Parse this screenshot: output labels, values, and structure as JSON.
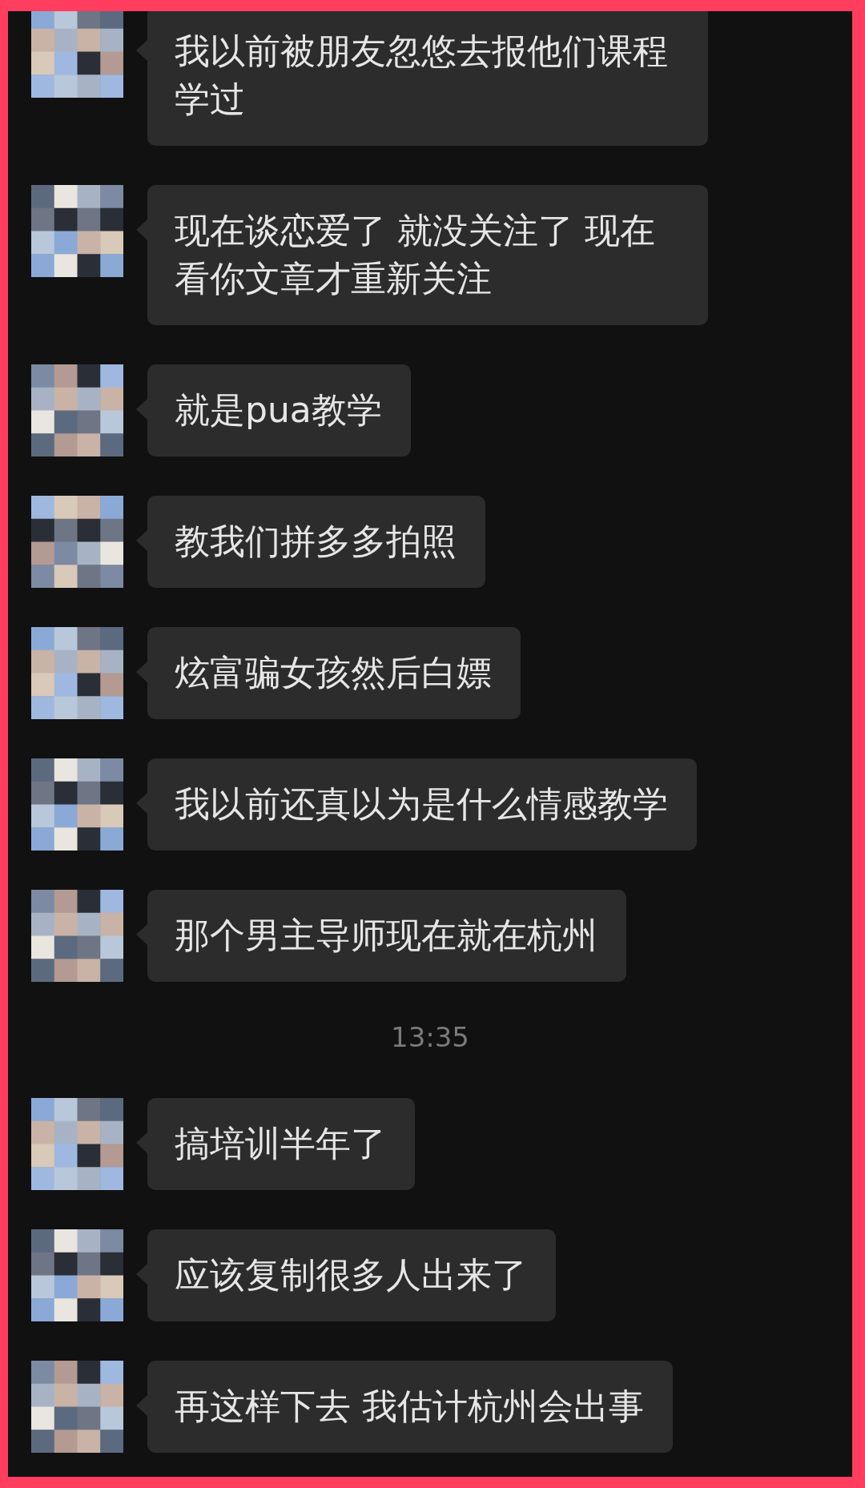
{
  "messages": [
    {
      "kind": "message",
      "text": "我以前被朋友忽悠去报他们课程学过"
    },
    {
      "kind": "message",
      "text": "现在谈恋爱了 就没关注了 现在看你文章才重新关注"
    },
    {
      "kind": "message",
      "text": "就是pua教学"
    },
    {
      "kind": "message",
      "text": "教我们拼多多拍照"
    },
    {
      "kind": "message",
      "text": "炫富骗女孩然后白嫖"
    },
    {
      "kind": "message",
      "text": "我以前还真以为是什么情感教学"
    },
    {
      "kind": "message",
      "text": "那个男主导师现在就在杭州"
    },
    {
      "kind": "time",
      "text": "13:35"
    },
    {
      "kind": "message",
      "text": "搞培训半年了"
    },
    {
      "kind": "message",
      "text": "应该复制很多人出来了"
    },
    {
      "kind": "message",
      "text": "再这样下去 我估计杭州会出事"
    }
  ]
}
